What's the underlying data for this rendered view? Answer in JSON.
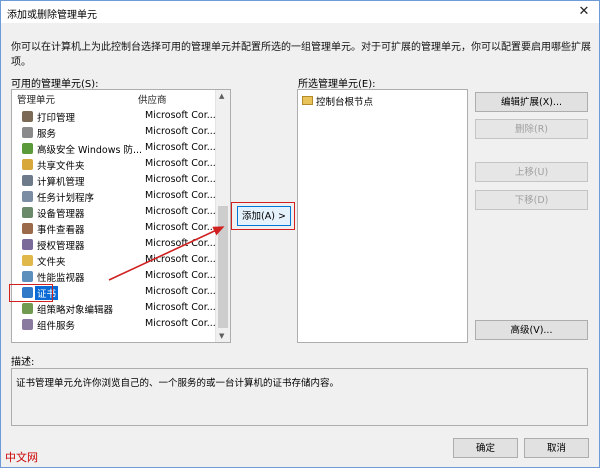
{
  "window": {
    "title": "添加或删除管理单元",
    "close_glyph": "✕"
  },
  "intro_text": "你可以在计算机上为此控制台选择可用的管理单元并配置所选的一组管理单元。对于可扩展的管理单元，你可以配置要启用哪些扩展项。",
  "available": {
    "label": "可用的管理单元(S):",
    "col_name": "管理单元",
    "col_vendor": "供应商",
    "items": [
      {
        "name": "打印管理",
        "vendor": "Microsoft Cor...",
        "icon": "printer-icon"
      },
      {
        "name": "服务",
        "vendor": "Microsoft Cor...",
        "icon": "services-gear-icon"
      },
      {
        "name": "高级安全 Windows 防...",
        "vendor": "Microsoft Cor...",
        "icon": "firewall-icon"
      },
      {
        "name": "共享文件夹",
        "vendor": "Microsoft Cor...",
        "icon": "shared-folder-icon"
      },
      {
        "name": "计算机管理",
        "vendor": "Microsoft Cor...",
        "icon": "computer-management-icon"
      },
      {
        "name": "任务计划程序",
        "vendor": "Microsoft Cor...",
        "icon": "task-scheduler-icon"
      },
      {
        "name": "设备管理器",
        "vendor": "Microsoft Cor...",
        "icon": "device-manager-icon"
      },
      {
        "name": "事件查看器",
        "vendor": "Microsoft Cor...",
        "icon": "event-viewer-icon"
      },
      {
        "name": "授权管理器",
        "vendor": "Microsoft Cor...",
        "icon": "authorization-manager-icon"
      },
      {
        "name": "文件夹",
        "vendor": "Microsoft Cor...",
        "icon": "folder-icon"
      },
      {
        "name": "性能监视器",
        "vendor": "Microsoft Cor...",
        "icon": "performance-monitor-icon"
      },
      {
        "name": "证书",
        "vendor": "Microsoft Cor...",
        "icon": "certificate-icon",
        "selected": true
      },
      {
        "name": "组策略对象编辑器",
        "vendor": "Microsoft Cor...",
        "icon": "group-policy-icon"
      },
      {
        "name": "组件服务",
        "vendor": "Microsoft Cor...",
        "icon": "component-services-icon"
      }
    ]
  },
  "add_button": "添加(A) >",
  "selected": {
    "label": "所选管理单元(E):",
    "items": [
      {
        "name": "控制台根节点",
        "icon": "folder-icon"
      }
    ]
  },
  "buttons": {
    "edit_extensions": "编辑扩展(X)...",
    "remove": "删除(R)",
    "move_up": "上移(U)",
    "move_down": "下移(D)",
    "advanced": "高级(V)...",
    "ok": "确定",
    "cancel": "取消"
  },
  "description": {
    "label": "描述:",
    "text": "证书管理单元允许你浏览自己的、一个服务的或一台计算机的证书存储内容。"
  },
  "watermark": "中文网",
  "colors": {
    "accent": "#0b6bd6",
    "highlight": "#d02020",
    "border": "#6f9ad8"
  }
}
